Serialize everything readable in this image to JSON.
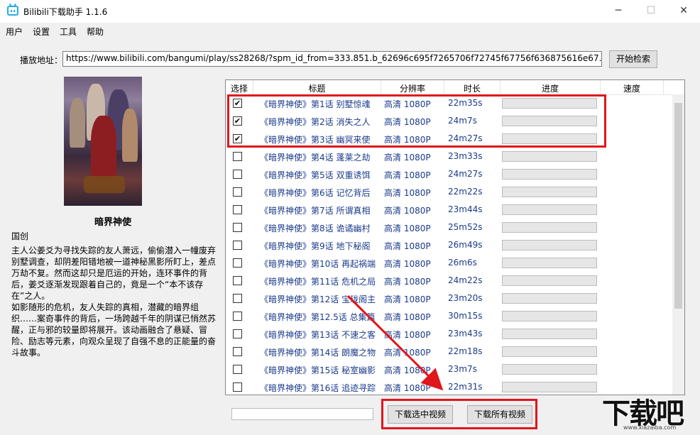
{
  "window": {
    "title": "Bilibili下载助手 1.1.6",
    "minimize": "─",
    "maximize": "☐",
    "close": "✕"
  },
  "menu": [
    "用户",
    "设置",
    "工具",
    "帮助"
  ],
  "url_label": "播放地址：",
  "url_value": "https://www.bilibili.com/bangumi/play/ss28268/?spm_id_from=333.851.b_62696c695f7265706f72745f67756f636875616e67.7",
  "search_button": "开始检索",
  "series": {
    "title": "暗界神使",
    "genre": "国创",
    "description": "主人公姜爻为寻找失踪的友人萧远，偷偷潜入一幢废弃别墅调查，却阴差阳错地被一道神秘黑影所盯上，差点万劫不复。然而这却只是厄运的开始，连环事件的背后，姜爻逐渐发现跟着自己的，竟是一个“本不该存在”之人。\n如影随形的危机，友人失踪的真相，潜藏的暗界组织……案奇事件的背后，一场跨越千年的阴谋已悄然苏醒，正与邪的较量即将展开。该动画融合了悬疑、冒险、励志等元素，向观众呈现了自强不息的正能量的奋斗故事。"
  },
  "table": {
    "headers": [
      "选择",
      "标题",
      "分辨率",
      "时长",
      "进度",
      "速度"
    ],
    "rows": [
      {
        "checked": true,
        "title": "《暗界神使》第1话 别墅惊魂",
        "resolution": "高清 1080P",
        "duration": "22m35s",
        "progress": 0
      },
      {
        "checked": true,
        "title": "《暗界神使》第2话 消失之人",
        "resolution": "高清 1080P",
        "duration": "24m7s",
        "progress": 0
      },
      {
        "checked": true,
        "title": "《暗界神使》第3话 幽冥来使",
        "resolution": "高清 1080P",
        "duration": "24m27s",
        "progress": 0
      },
      {
        "checked": false,
        "title": "《暗界神使》第4话 蓬莱之劫",
        "resolution": "高清 1080P",
        "duration": "23m33s",
        "progress": 0
      },
      {
        "checked": false,
        "title": "《暗界神使》第5话 双重诱饵",
        "resolution": "高清 1080P",
        "duration": "24m27s",
        "progress": 0
      },
      {
        "checked": false,
        "title": "《暗界神使》第6话 记忆背后",
        "resolution": "高清 1080P",
        "duration": "22m22s",
        "progress": 0
      },
      {
        "checked": false,
        "title": "《暗界神使》第7话 所谓真相",
        "resolution": "高清 1080P",
        "duration": "23m44s",
        "progress": 0
      },
      {
        "checked": false,
        "title": "《暗界神使》第8话 诡谲幽村",
        "resolution": "高清 1080P",
        "duration": "25m52s",
        "progress": 0
      },
      {
        "checked": false,
        "title": "《暗界神使》第9话 地下秘阁",
        "resolution": "高清 1080P",
        "duration": "26m49s",
        "progress": 0
      },
      {
        "checked": false,
        "title": "《暗界神使》第10话 再起祸端",
        "resolution": "高清 1080P",
        "duration": "26m6s",
        "progress": 0
      },
      {
        "checked": false,
        "title": "《暗界神使》第11话 危机之局",
        "resolution": "高清 1080P",
        "duration": "24m22s",
        "progress": 0
      },
      {
        "checked": false,
        "title": "《暗界神使》第12话 宝珑阁主",
        "resolution": "高清 1080P",
        "duration": "23m20s",
        "progress": 0
      },
      {
        "checked": false,
        "title": "《暗界神使》第12.5话 总集篇",
        "resolution": "高清 1080P",
        "duration": "30m15s",
        "progress": 0
      },
      {
        "checked": false,
        "title": "《暗界神使》第13话 不速之客",
        "resolution": "高清 1080P",
        "duration": "23m43s",
        "progress": 0
      },
      {
        "checked": false,
        "title": "《暗界神使》第14话 朗魔之物",
        "resolution": "高清 1080P",
        "duration": "22m18s",
        "progress": 0
      },
      {
        "checked": false,
        "title": "《暗界神使》第15话 秘室幽影",
        "resolution": "高清 1080P",
        "duration": "23m7s",
        "progress": 0
      },
      {
        "checked": false,
        "title": "《暗界神使》第16话 追迹寻踪",
        "resolution": "高清 1080P",
        "duration": "22m31s",
        "progress": 0
      }
    ]
  },
  "buttons": {
    "download_selected": "下载选中视频",
    "download_all": "下载所有视频"
  },
  "watermark": {
    "text": "下载吧",
    "url": "www.xiazaiba.com"
  },
  "colors": {
    "highlight": "#e0161c",
    "episode_text": "#1a3a8a",
    "accent": "#23ade5"
  }
}
